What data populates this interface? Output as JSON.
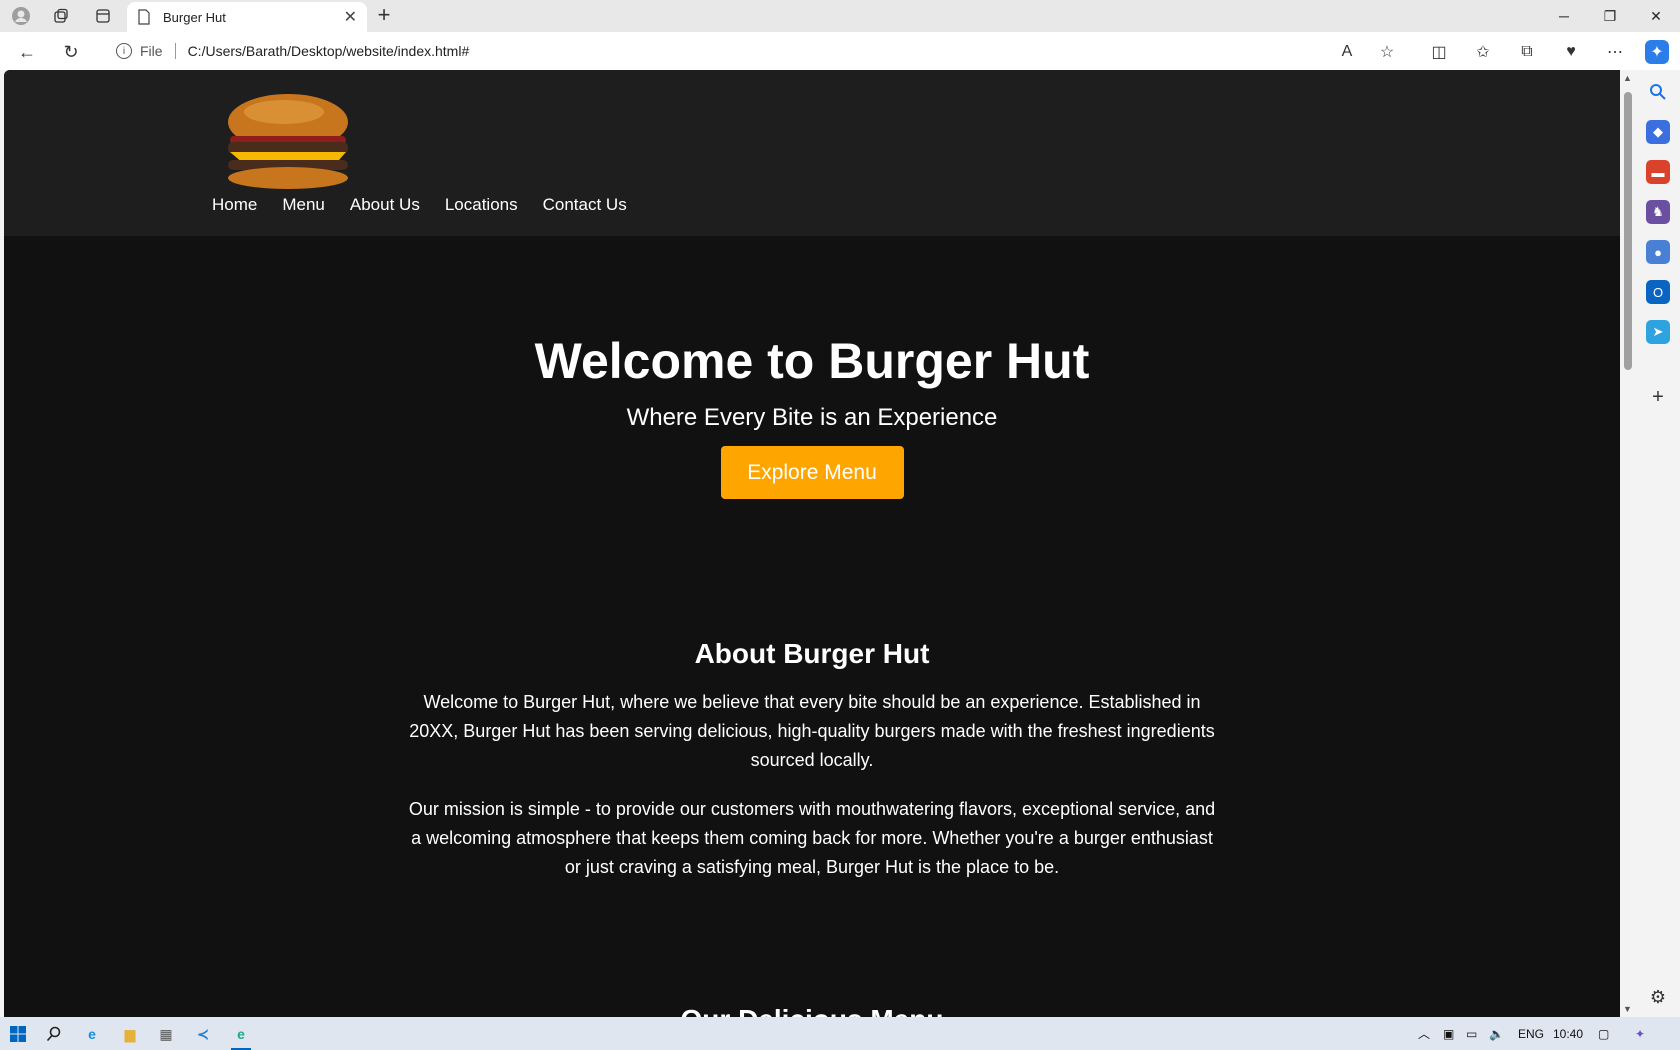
{
  "browser": {
    "tab_title": "Burger Hut",
    "address_scheme": "File",
    "address_url": "C:/Users/Barath/Desktop/website/index.html#"
  },
  "site": {
    "nav": [
      "Home",
      "Menu",
      "About Us",
      "Locations",
      "Contact Us"
    ],
    "hero": {
      "title": "Welcome to Burger Hut",
      "tagline": "Where Every Bite is an Experience",
      "cta": "Explore Menu"
    },
    "about": {
      "heading": "About Burger Hut",
      "p1": "Welcome to Burger Hut, where we believe that every bite should be an experience. Established in 20XX, Burger Hut has been serving delicious, high-quality burgers made with the freshest ingredients sourced locally.",
      "p2": "Our mission is simple - to provide our customers with mouthwatering flavors, exceptional service, and a welcoming atmosphere that keeps them coming back for more. Whether you're a burger enthusiast or just craving a satisfying meal, Burger Hut is the place to be."
    },
    "next_section_heading": "Our Delicious Menu"
  },
  "taskbar": {
    "lang": "ENG",
    "time": "10:40"
  },
  "colors": {
    "accent": "#ffa500",
    "header_bg": "#1e1e1e",
    "page_bg": "#111111"
  }
}
